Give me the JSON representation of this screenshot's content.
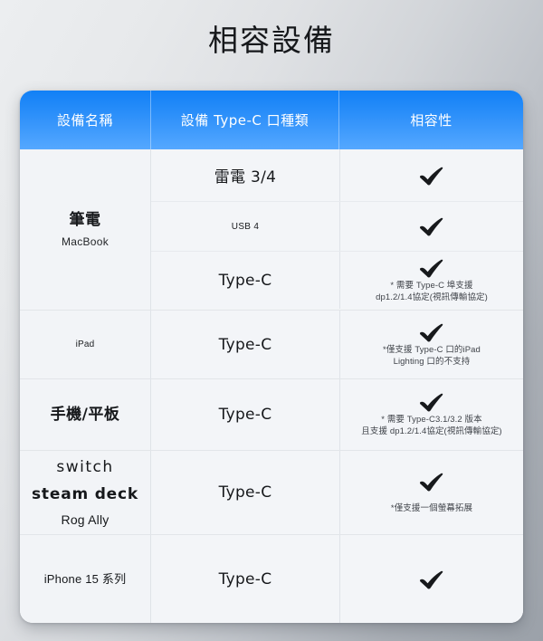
{
  "page": {
    "title": "相容設備",
    "background_from": "#eceef0",
    "background_to": "#9ba1a9"
  },
  "table": {
    "header": {
      "accent_color": "#1180f6",
      "columns": [
        "設備名稱",
        "設備 Type-C 口種類",
        "相容性"
      ]
    },
    "rows": [
      {
        "name_main": "筆電",
        "name_sub": "MacBook",
        "subrows": [
          {
            "port": "雷電 3/4",
            "port_size": "large",
            "compatible": true,
            "notes": []
          },
          {
            "port": "USB 4",
            "port_size": "small",
            "compatible": true,
            "notes": []
          },
          {
            "port": "Type-C",
            "port_size": "large",
            "compatible": true,
            "notes": [
              "* 需要 Type-C 埠支援",
              "dp1.2/1.4協定(視訊傳輸協定)"
            ]
          }
        ]
      },
      {
        "name_tiny": "iPad",
        "subrows": [
          {
            "port": "Type-C",
            "port_size": "large",
            "compatible": true,
            "notes": [
              "*僅支援 Type-C 口的iPad",
              "Lighting 口的不支持"
            ]
          }
        ]
      },
      {
        "name_main": "手機/平板",
        "subrows": [
          {
            "port": "Type-C",
            "port_size": "large",
            "compatible": true,
            "notes": [
              "* 需要 Type-C3.1/3.2 版本",
              "且支援 dp1.2/1.4協定(視訊傳輸協定)"
            ]
          }
        ]
      },
      {
        "name_lines": [
          "switch",
          "steam deck",
          "Rog Ally"
        ],
        "subrows": [
          {
            "port": "Type-C",
            "port_size": "large",
            "compatible": true,
            "notes": [
              "*僅支援一個螢幕拓展"
            ]
          }
        ]
      },
      {
        "name_mid": "iPhone 15 系列",
        "subrows": [
          {
            "port": "Type-C",
            "port_size": "large",
            "compatible": true,
            "notes": []
          }
        ]
      }
    ]
  },
  "icons": {
    "check": "check-mark-icon"
  }
}
